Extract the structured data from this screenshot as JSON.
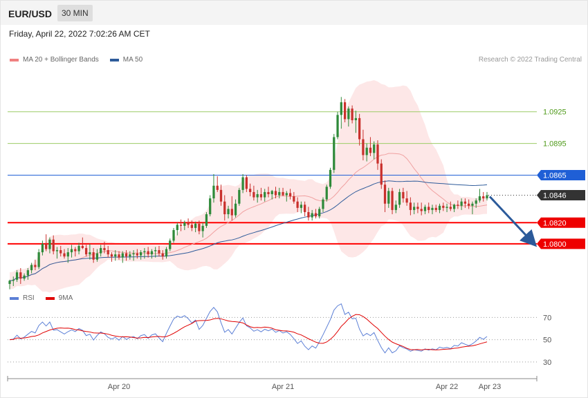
{
  "header": {
    "symbol": "EUR/USD",
    "timeframe": "30 MIN"
  },
  "datetime": "Friday, April 22, 2022 7:02:26 AM CET",
  "legend_price": [
    {
      "label": "MA 20 + Bollinger Bands",
      "color": "#f08080"
    },
    {
      "label": "MA 50",
      "color": "#2e5b9a"
    }
  ],
  "legend_rsi": [
    {
      "label": "RSI",
      "color": "#5b7fd6"
    },
    {
      "label": "9MA",
      "color": "#e00000"
    }
  ],
  "credit": "Research © 2022 Trading Central",
  "colors": {
    "up": "#2f8a3a",
    "down": "#c9302c",
    "band": "#fde4e4",
    "ma20": "#f0a0a0",
    "ma50": "#2e5b9a",
    "resistance": "#ff0000",
    "pivot": "#1f5fd6",
    "target": "#9ccc65",
    "arrow": "#2b5a9a"
  },
  "chart_data": {
    "type": "candlestick",
    "price_range": [
      1.076,
      1.0968
    ],
    "levels": [
      {
        "label": "1.0925",
        "value": 1.0925,
        "kind": "target"
      },
      {
        "label": "1.0895",
        "value": 1.0895,
        "kind": "target"
      },
      {
        "label": "1.0865",
        "value": 1.0865,
        "kind": "pivot"
      },
      {
        "label": "1.0846",
        "value": 1.0846,
        "kind": "current"
      },
      {
        "label": "1.0820",
        "value": 1.082,
        "kind": "support"
      },
      {
        "label": "1.0800",
        "value": 1.08,
        "kind": "support"
      }
    ],
    "x_ticks": [
      "Apr 20",
      "Apr 21",
      "Apr 22",
      "Apr 23"
    ],
    "x_tick_index": [
      30,
      75,
      120,
      134
    ],
    "candles": [
      [
        1.0762,
        1.0766,
        1.0757,
        1.0765
      ],
      [
        1.0765,
        1.0769,
        1.076,
        1.0766
      ],
      [
        1.0766,
        1.0775,
        1.0764,
        1.0773
      ],
      [
        1.0773,
        1.0777,
        1.0762,
        1.0767
      ],
      [
        1.0767,
        1.0772,
        1.0765,
        1.077
      ],
      [
        1.077,
        1.0777,
        1.0766,
        1.0775
      ],
      [
        1.0775,
        1.0782,
        1.0772,
        1.078
      ],
      [
        1.078,
        1.0785,
        1.0775,
        1.0778
      ],
      [
        1.0778,
        1.0795,
        1.0776,
        1.0792
      ],
      [
        1.0792,
        1.0803,
        1.0789,
        1.08
      ],
      [
        1.08,
        1.0809,
        1.0793,
        1.0795
      ],
      [
        1.0795,
        1.0806,
        1.0791,
        1.0804
      ],
      [
        1.0804,
        1.0808,
        1.079,
        1.0793
      ],
      [
        1.0793,
        1.0797,
        1.0786,
        1.0794
      ],
      [
        1.0794,
        1.0798,
        1.0788,
        1.0791
      ],
      [
        1.0791,
        1.0795,
        1.0786,
        1.0788
      ],
      [
        1.0788,
        1.0796,
        1.0782,
        1.0792
      ],
      [
        1.0792,
        1.0799,
        1.0787,
        1.0795
      ],
      [
        1.0795,
        1.0797,
        1.0788,
        1.0793
      ],
      [
        1.0793,
        1.0801,
        1.079,
        1.0798
      ],
      [
        1.0798,
        1.0806,
        1.0795,
        1.0796
      ],
      [
        1.0796,
        1.0799,
        1.0788,
        1.079
      ],
      [
        1.079,
        1.08,
        1.0785,
        1.0792
      ],
      [
        1.0792,
        1.0796,
        1.0782,
        1.0785
      ],
      [
        1.0785,
        1.0795,
        1.0783,
        1.0791
      ],
      [
        1.0791,
        1.0799,
        1.0788,
        1.0796
      ],
      [
        1.0796,
        1.0802,
        1.0791,
        1.0794
      ],
      [
        1.0794,
        1.0798,
        1.0787,
        1.079
      ],
      [
        1.079,
        1.0792,
        1.0783,
        1.0788
      ],
      [
        1.0788,
        1.0794,
        1.0784,
        1.079
      ],
      [
        1.079,
        1.0793,
        1.0785,
        1.0787
      ],
      [
        1.0787,
        1.0793,
        1.0782,
        1.0791
      ],
      [
        1.0791,
        1.0794,
        1.0784,
        1.0788
      ],
      [
        1.0788,
        1.0793,
        1.0785,
        1.079
      ],
      [
        1.079,
        1.0794,
        1.0784,
        1.0791
      ],
      [
        1.0791,
        1.0795,
        1.0786,
        1.0789
      ],
      [
        1.0789,
        1.0794,
        1.0785,
        1.0792
      ],
      [
        1.0792,
        1.0796,
        1.0786,
        1.0793
      ],
      [
        1.0793,
        1.0797,
        1.0787,
        1.079
      ],
      [
        1.079,
        1.0795,
        1.0786,
        1.0793
      ],
      [
        1.0793,
        1.0797,
        1.0787,
        1.0794
      ],
      [
        1.0794,
        1.0798,
        1.0788,
        1.0791
      ],
      [
        1.0791,
        1.0794,
        1.0785,
        1.0788
      ],
      [
        1.0788,
        1.0797,
        1.0786,
        1.0795
      ],
      [
        1.0795,
        1.0805,
        1.0793,
        1.0803
      ],
      [
        1.0803,
        1.0815,
        1.0801,
        1.0813
      ],
      [
        1.0813,
        1.082,
        1.0808,
        1.0818
      ],
      [
        1.0818,
        1.0823,
        1.0812,
        1.0817
      ],
      [
        1.0817,
        1.0822,
        1.0813,
        1.082
      ],
      [
        1.082,
        1.0824,
        1.0815,
        1.0818
      ],
      [
        1.0818,
        1.0822,
        1.0812,
        1.0815
      ],
      [
        1.0815,
        1.0821,
        1.0811,
        1.0819
      ],
      [
        1.0819,
        1.0822,
        1.0809,
        1.0812
      ],
      [
        1.0812,
        1.082,
        1.0806,
        1.0817
      ],
      [
        1.0817,
        1.083,
        1.0815,
        1.0828
      ],
      [
        1.0828,
        1.0846,
        1.0826,
        1.0843
      ],
      [
        1.0843,
        1.0866,
        1.0839,
        1.0855
      ],
      [
        1.0855,
        1.0864,
        1.0849,
        1.0851
      ],
      [
        1.0851,
        1.0856,
        1.0836,
        1.084
      ],
      [
        1.084,
        1.0846,
        1.0822,
        1.0828
      ],
      [
        1.0828,
        1.0836,
        1.0824,
        1.0833
      ],
      [
        1.0833,
        1.0845,
        1.0822,
        1.0827
      ],
      [
        1.0827,
        1.0842,
        1.0825,
        1.0838
      ],
      [
        1.0838,
        1.0853,
        1.0836,
        1.0851
      ],
      [
        1.0851,
        1.0866,
        1.0848,
        1.0863
      ],
      [
        1.0863,
        1.0865,
        1.0849,
        1.0852
      ],
      [
        1.0852,
        1.0857,
        1.0845,
        1.0849
      ],
      [
        1.0849,
        1.0855,
        1.0841,
        1.0844
      ],
      [
        1.0844,
        1.0851,
        1.0839,
        1.0847
      ],
      [
        1.0847,
        1.0853,
        1.0841,
        1.0844
      ],
      [
        1.0844,
        1.0852,
        1.084,
        1.0849
      ],
      [
        1.0849,
        1.0854,
        1.0844,
        1.0847
      ],
      [
        1.0847,
        1.0851,
        1.0842,
        1.085
      ],
      [
        1.085,
        1.0854,
        1.0843,
        1.0846
      ],
      [
        1.0846,
        1.0853,
        1.0843,
        1.0849
      ],
      [
        1.0849,
        1.0853,
        1.0845,
        1.0846
      ],
      [
        1.0846,
        1.085,
        1.084,
        1.0848
      ],
      [
        1.0848,
        1.0852,
        1.0842,
        1.0845
      ],
      [
        1.0845,
        1.0849,
        1.0838,
        1.084
      ],
      [
        1.084,
        1.0844,
        1.083,
        1.0834
      ],
      [
        1.0834,
        1.084,
        1.0829,
        1.0837
      ],
      [
        1.0837,
        1.084,
        1.0826,
        1.083
      ],
      [
        1.083,
        1.0835,
        1.0822,
        1.0825
      ],
      [
        1.0825,
        1.0832,
        1.0822,
        1.0829
      ],
      [
        1.0829,
        1.0833,
        1.0824,
        1.0826
      ],
      [
        1.0826,
        1.0835,
        1.0824,
        1.0833
      ],
      [
        1.0833,
        1.0844,
        1.083,
        1.0842
      ],
      [
        1.0842,
        1.0856,
        1.084,
        1.0854
      ],
      [
        1.0854,
        1.0872,
        1.0852,
        1.087
      ],
      [
        1.087,
        1.0904,
        1.0867,
        1.0901
      ],
      [
        1.0901,
        1.0925,
        1.0899,
        1.0922
      ],
      [
        1.0922,
        1.0939,
        1.0909,
        1.0934
      ],
      [
        1.0934,
        1.0937,
        1.0915,
        1.0918
      ],
      [
        1.0918,
        1.093,
        1.0911,
        1.0928
      ],
      [
        1.0928,
        1.0931,
        1.0914,
        1.0917
      ],
      [
        1.0917,
        1.0926,
        1.0905,
        1.0919
      ],
      [
        1.0919,
        1.0923,
        1.0893,
        1.0899
      ],
      [
        1.0899,
        1.0908,
        1.0879,
        1.0884
      ],
      [
        1.0884,
        1.0895,
        1.0878,
        1.0891
      ],
      [
        1.0891,
        1.0901,
        1.0883,
        1.0886
      ],
      [
        1.0886,
        1.0897,
        1.088,
        1.0894
      ],
      [
        1.0894,
        1.0898,
        1.087,
        1.0876
      ],
      [
        1.0876,
        1.088,
        1.0852,
        1.0856
      ],
      [
        1.0856,
        1.086,
        1.083,
        1.0838
      ],
      [
        1.0838,
        1.0853,
        1.0834,
        1.085
      ],
      [
        1.085,
        1.0853,
        1.0828,
        1.0832
      ],
      [
        1.0832,
        1.0841,
        1.0829,
        1.0837
      ],
      [
        1.0837,
        1.0852,
        1.0834,
        1.0849
      ],
      [
        1.0849,
        1.0853,
        1.0839,
        1.0843
      ],
      [
        1.0843,
        1.085,
        1.0836,
        1.0839
      ],
      [
        1.0839,
        1.0844,
        1.0827,
        1.0832
      ],
      [
        1.0832,
        1.0839,
        1.0828,
        1.0835
      ],
      [
        1.0835,
        1.0839,
        1.0829,
        1.0833
      ],
      [
        1.0833,
        1.0839,
        1.0827,
        1.0831
      ],
      [
        1.0831,
        1.0837,
        1.0828,
        1.0835
      ],
      [
        1.0835,
        1.0839,
        1.0829,
        1.0832
      ],
      [
        1.0832,
        1.0837,
        1.0828,
        1.0834
      ],
      [
        1.0834,
        1.0837,
        1.083,
        1.0832
      ],
      [
        1.0832,
        1.0838,
        1.0829,
        1.0836
      ],
      [
        1.0836,
        1.0839,
        1.0831,
        1.0834
      ],
      [
        1.0834,
        1.0838,
        1.083,
        1.0835
      ],
      [
        1.0835,
        1.084,
        1.0831,
        1.0833
      ],
      [
        1.0833,
        1.0838,
        1.083,
        1.0837
      ],
      [
        1.0837,
        1.0841,
        1.0833,
        1.0836
      ],
      [
        1.0836,
        1.0843,
        1.0832,
        1.084
      ],
      [
        1.084,
        1.0843,
        1.0834,
        1.0838
      ],
      [
        1.0838,
        1.0842,
        1.0833,
        1.0836
      ],
      [
        1.0836,
        1.084,
        1.0828,
        1.0838
      ],
      [
        1.0838,
        1.0843,
        1.0834,
        1.0841
      ],
      [
        1.0841,
        1.0852,
        1.0839,
        1.0845
      ],
      [
        1.0845,
        1.0849,
        1.084,
        1.0843
      ],
      [
        1.0843,
        1.0849,
        1.0841,
        1.0846
      ]
    ],
    "rsi_range": [
      20,
      82
    ],
    "rsi_levels": [
      {
        "label": "70",
        "value": 70
      },
      {
        "label": "50",
        "value": 50
      },
      {
        "label": "30",
        "value": 30
      }
    ]
  }
}
